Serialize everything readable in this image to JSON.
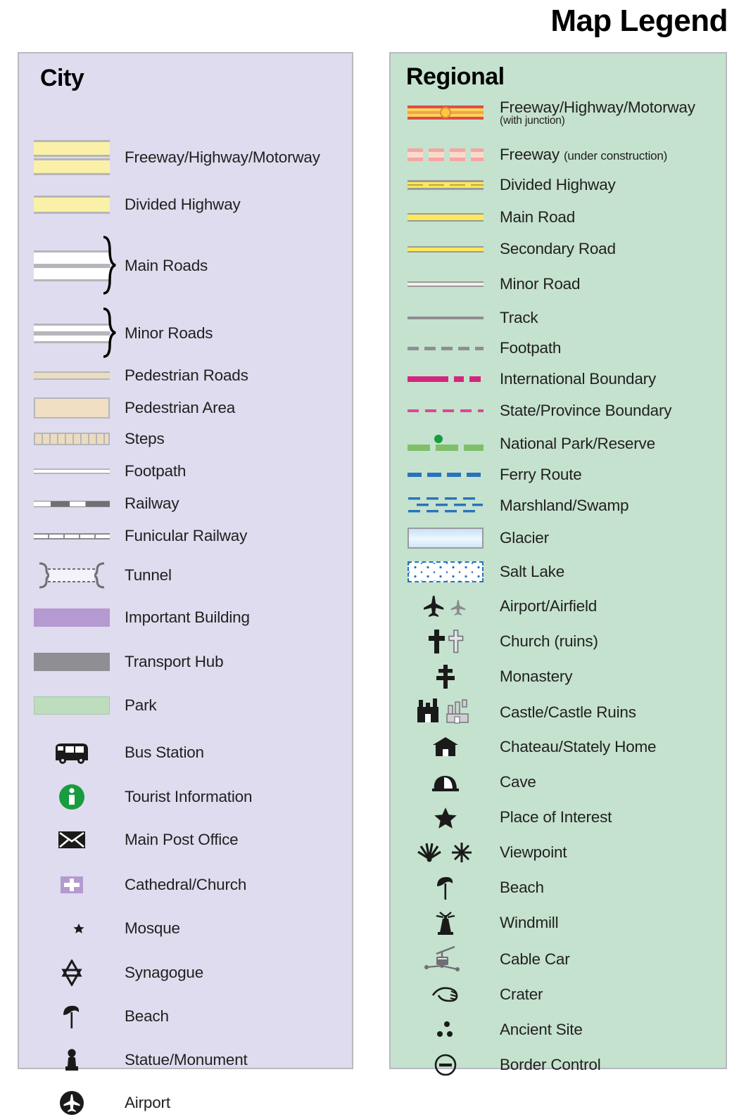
{
  "title": "Map Legend",
  "colors": {
    "city_panel_bg": "#dedcee",
    "regional_panel_bg": "#c4e2ce",
    "panel_border": "#b9b9c0",
    "text": "#221f1f",
    "freeway_yellow": "#fbf0a8",
    "freeway_red": "#e04b4b",
    "junction_yellow": "#fbc93f",
    "road_yellow": "#fbe95a",
    "pedestrian_tan": "#ecdcbf",
    "important_building_purple": "#b49ad0",
    "transport_hub_grey": "#8e8e93",
    "park_green": "#bedcbe",
    "tourist_info_green": "#179c3f",
    "boundary_magenta": "#d6257f",
    "state_boundary_pink": "#e0459a",
    "national_park_green": "#7fbf6a",
    "ferry_blue": "#2a72bd",
    "glacier_blue": "#c6e2f5"
  },
  "city": {
    "heading": "City",
    "items": [
      {
        "label": "Freeway/Highway/Motorway",
        "icon": "freeway-double-band-icon"
      },
      {
        "label": "Divided Highway",
        "icon": "divided-highway-band-icon"
      },
      {
        "label": "Main Roads",
        "icon": "main-roads-bands-icon"
      },
      {
        "label": "Minor Roads",
        "icon": "minor-roads-bands-icon"
      },
      {
        "label": "Pedestrian Roads",
        "icon": "pedestrian-road-band-icon"
      },
      {
        "label": "Pedestrian Area",
        "icon": "pedestrian-area-block-icon"
      },
      {
        "label": "Steps",
        "icon": "steps-icon"
      },
      {
        "label": "Footpath",
        "icon": "footpath-line-icon"
      },
      {
        "label": "Railway",
        "icon": "railway-line-icon"
      },
      {
        "label": "Funicular Railway",
        "icon": "funicular-railway-line-icon"
      },
      {
        "label": "Tunnel",
        "icon": "tunnel-icon"
      },
      {
        "label": "Important Building",
        "icon": "important-building-block-icon"
      },
      {
        "label": "Transport Hub",
        "icon": "transport-hub-block-icon"
      },
      {
        "label": "Park",
        "icon": "park-block-icon"
      },
      {
        "label": "Bus Station",
        "icon": "bus-icon"
      },
      {
        "label": "Tourist Information",
        "icon": "information-circle-icon"
      },
      {
        "label": "Main Post Office",
        "icon": "envelope-icon"
      },
      {
        "label": "Cathedral/Church",
        "icon": "church-cross-square-icon"
      },
      {
        "label": "Mosque",
        "icon": "star-and-crescent-icon"
      },
      {
        "label": "Synagogue",
        "icon": "star-of-david-icon"
      },
      {
        "label": "Beach",
        "icon": "beach-umbrella-icon"
      },
      {
        "label": "Statue/Monument",
        "icon": "statue-monument-icon"
      },
      {
        "label": "Airport",
        "icon": "airplane-circle-icon"
      }
    ]
  },
  "regional": {
    "heading": "Regional",
    "items": [
      {
        "label": "Freeway/Highway/Motorway",
        "sublabel": "(with junction)",
        "sublabel_style": "block",
        "icon": "freeway-with-junction-icon"
      },
      {
        "label": "Freeway",
        "sublabel": "(under construction)",
        "sublabel_style": "inline",
        "icon": "freeway-under-construction-icon"
      },
      {
        "label": "Divided Highway",
        "icon": "divided-highway-line-icon"
      },
      {
        "label": "Main Road",
        "icon": "main-road-line-icon"
      },
      {
        "label": "Secondary Road",
        "icon": "secondary-road-line-icon"
      },
      {
        "label": "Minor Road",
        "icon": "minor-road-line-icon"
      },
      {
        "label": "Track",
        "icon": "track-line-icon"
      },
      {
        "label": "Footpath",
        "icon": "footpath-dashed-icon"
      },
      {
        "label": "International Boundary",
        "icon": "international-boundary-icon"
      },
      {
        "label": "State/Province Boundary",
        "icon": "state-boundary-icon"
      },
      {
        "label": "National Park/Reserve",
        "icon": "national-park-icon"
      },
      {
        "label": "Ferry Route",
        "icon": "ferry-route-icon"
      },
      {
        "label": "Marshland/Swamp",
        "icon": "marshland-icon"
      },
      {
        "label": "Glacier",
        "icon": "glacier-icon"
      },
      {
        "label": "Salt Lake",
        "icon": "salt-lake-icon"
      },
      {
        "label": "Airport/Airfield",
        "icon": "airplane-pair-icon"
      },
      {
        "label": "Church (ruins)",
        "icon": "church-cross-pair-icon"
      },
      {
        "label": "Monastery",
        "icon": "monastery-cross-icon"
      },
      {
        "label": "Castle/Castle Ruins",
        "icon": "castle-pair-icon"
      },
      {
        "label": "Chateau/Stately Home",
        "icon": "chateau-icon"
      },
      {
        "label": "Cave",
        "icon": "cave-icon"
      },
      {
        "label": "Place of Interest",
        "icon": "star-icon"
      },
      {
        "label": "Viewpoint",
        "icon": "viewpoint-pair-icon"
      },
      {
        "label": "Beach",
        "icon": "beach-umbrella-icon"
      },
      {
        "label": "Windmill",
        "icon": "windmill-icon"
      },
      {
        "label": "Cable Car",
        "icon": "cable-car-icon"
      },
      {
        "label": "Crater",
        "icon": "crater-icon"
      },
      {
        "label": "Ancient Site",
        "icon": "ancient-site-dots-icon"
      },
      {
        "label": "Border Control",
        "icon": "border-control-icon"
      }
    ]
  }
}
